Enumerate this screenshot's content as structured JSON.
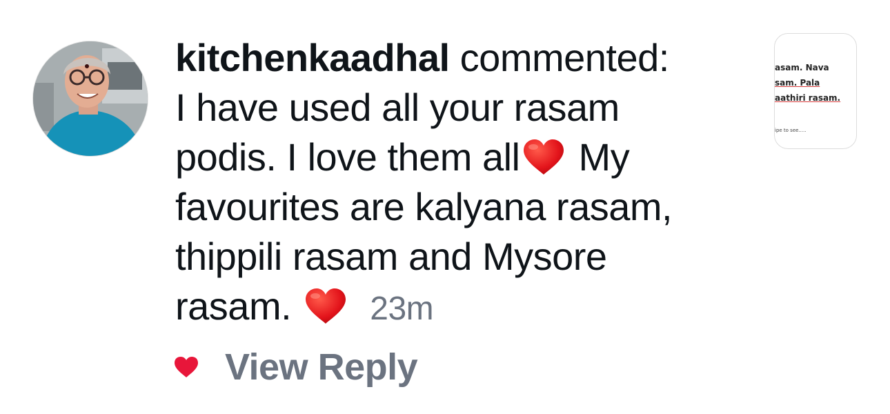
{
  "notification": {
    "username": "kitchenkaadhal",
    "action": "commented:",
    "comment_lines": [
      "I have used all your rasam",
      "podis. I love them all",
      "My",
      "favourites are kalyana rasam,",
      "thippili rasam and Mysore",
      "rasam."
    ],
    "time": "23m",
    "emoji": "red-heart-emoji"
  },
  "actions": {
    "like_icon": "heart-icon",
    "like_color": "#e8163a",
    "view_reply_label": "View Reply"
  },
  "post_thumbnail": {
    "lines": [
      "asam. Nava",
      "sam. Pala",
      "aathiri rasam."
    ],
    "swipe_text": "ipe to see....."
  },
  "colors": {
    "text": "#0f1419",
    "secondary": "#6b7380",
    "heart": "#e8163a"
  }
}
